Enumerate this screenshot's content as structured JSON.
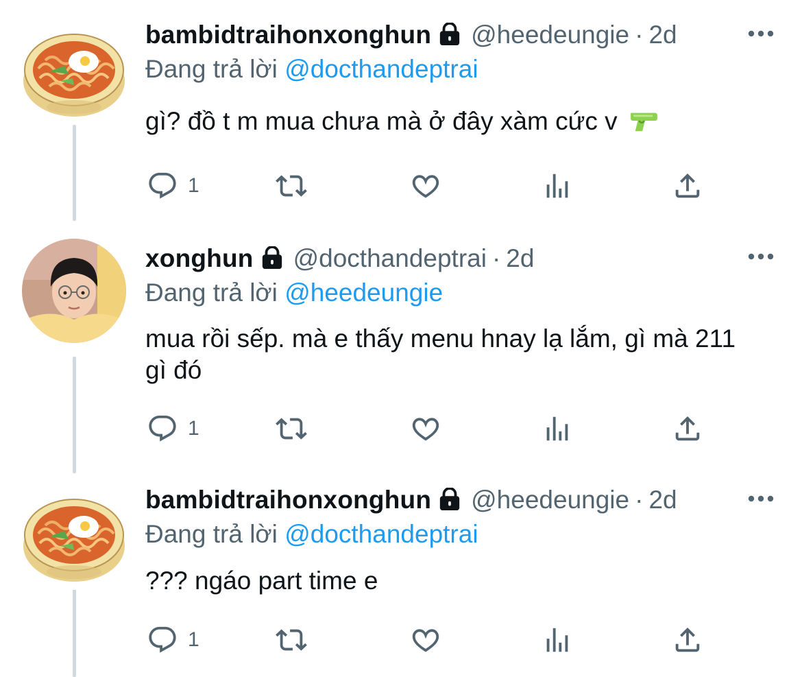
{
  "tweets": [
    {
      "display_name": "bambidtraihonxonghun",
      "handle": "@heedeungie",
      "time": "2d",
      "reply_prefix": "Đang trả lời",
      "reply_mention": "@docthandeptrai",
      "text": "gì? đồ t m mua chưa mà ở đây xàm cức v",
      "emoji": "water-pistol",
      "reply_count": "1",
      "avatar": "noodle-bowl-avatar"
    },
    {
      "display_name": "xonghun",
      "handle": "@docthandeptrai",
      "time": "2d",
      "reply_prefix": "Đang trả lời",
      "reply_mention": "@heedeungie",
      "text": "mua rồi sếp. mà e thấy menu hnay lạ lắm, gì mà 211 gì đó",
      "reply_count": "1",
      "avatar": "boy-with-glasses-avatar"
    },
    {
      "display_name": "bambidtraihonxonghun",
      "handle": "@heedeungie",
      "time": "2d",
      "reply_prefix": "Đang trả lời",
      "reply_mention": "@docthandeptrai",
      "text": "??? ngáo part time e",
      "reply_count": "1",
      "avatar": "noodle-bowl-avatar"
    }
  ],
  "separator": "·",
  "colors": {
    "mention": "#1d9bf0",
    "secondary": "#536471",
    "thread_line": "#cfd9de"
  }
}
